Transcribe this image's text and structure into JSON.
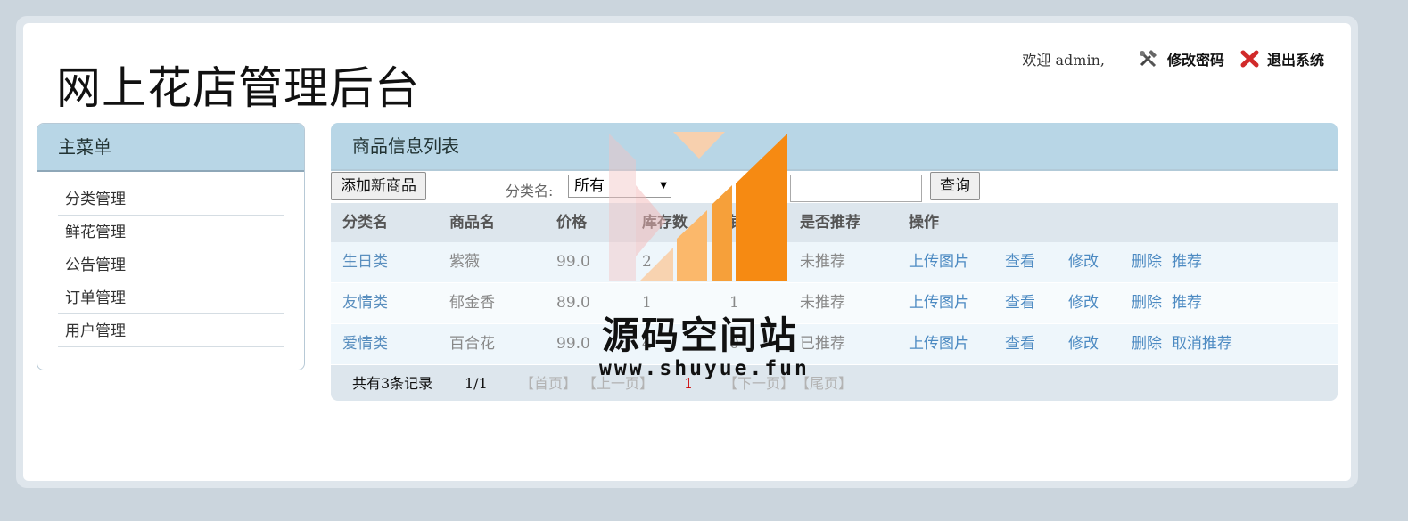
{
  "header": {
    "title": "网上花店管理后台",
    "welcome": "欢迎 admin,",
    "change_password": "修改密码",
    "logout": "退出系统"
  },
  "sidebar": {
    "title": "主菜单",
    "items": [
      {
        "label": "分类管理"
      },
      {
        "label": "鲜花管理"
      },
      {
        "label": "公告管理"
      },
      {
        "label": "订单管理"
      },
      {
        "label": "用户管理"
      }
    ]
  },
  "main": {
    "title": "商品信息列表",
    "add_button": "添加新商品",
    "category_label": "分类名:",
    "category_selected": "所有",
    "product_label": "商品",
    "search_button": "查询",
    "columns": [
      "分类名",
      "商品名",
      "价格",
      "库存数",
      "销量",
      "是否推荐",
      "操作"
    ],
    "rows": [
      {
        "category": "生日类",
        "name": "紫薇",
        "price": "99.0",
        "stock": "2",
        "sales": "",
        "recommend": "未推荐",
        "toggle": "推荐"
      },
      {
        "category": "友情类",
        "name": "郁金香",
        "price": "89.0",
        "stock": "1",
        "sales": "1",
        "recommend": "未推荐",
        "toggle": "推荐"
      },
      {
        "category": "爱情类",
        "name": "百合花",
        "price": "99.0",
        "stock": "4",
        "sales": "0",
        "recommend": "已推荐",
        "toggle": "取消推荐"
      }
    ],
    "actions": {
      "upload": "上传图片",
      "view": "查看",
      "edit": "修改",
      "delete": "删除"
    },
    "footer": {
      "total": "共有3条记录",
      "pages": "1/1",
      "first": "【首页】",
      "prev": "【上一页】",
      "current": "1",
      "next": "【下一页】",
      "last": "【尾页】"
    }
  },
  "watermark": {
    "name": "源码空间站",
    "url": "www.shuyue.fun"
  },
  "colors": {
    "header_bar": "#b8d6e6",
    "link_blue": "#4c8ac2",
    "watermark_orange": "#f68a12"
  }
}
